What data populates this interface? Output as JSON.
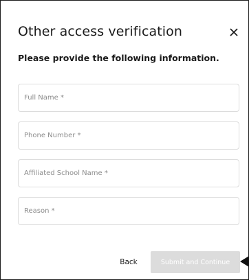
{
  "dialog": {
    "title": "Other access verification",
    "subtitle": "Please provide the following information.",
    "close_icon": "close-icon"
  },
  "fields": [
    {
      "placeholder": "Full Name *",
      "value": ""
    },
    {
      "placeholder": "Phone Number *",
      "value": ""
    },
    {
      "placeholder": "Affiliated School Name *",
      "value": ""
    },
    {
      "placeholder": "Reason *",
      "value": ""
    }
  ],
  "actions": {
    "back_label": "Back",
    "submit_label": "Submit and Continue",
    "submit_disabled": true
  },
  "colors": {
    "border": "#1c1c1c",
    "field_border": "#dcdcdc",
    "disabled_button": "#dcdcdc",
    "placeholder": "#8b8b8b"
  },
  "annotation": {
    "pointer_icon": "pointer-arrow-icon"
  }
}
